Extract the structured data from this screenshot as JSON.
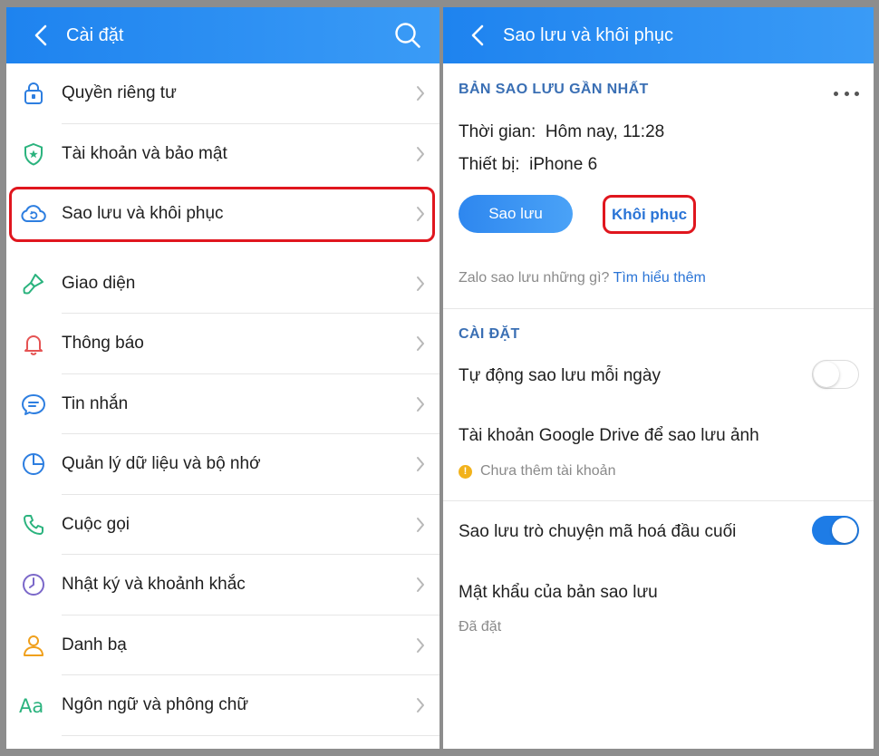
{
  "left": {
    "header": {
      "title": "Cài đặt"
    },
    "menu": [
      {
        "id": "privacy",
        "label": "Quyền riêng tư",
        "icon": "lock-icon"
      },
      {
        "id": "account",
        "label": "Tài khoản và bảo mật",
        "icon": "shield-icon"
      },
      {
        "id": "backup",
        "label": "Sao lưu và khôi phục",
        "icon": "cloud-sync-icon",
        "highlighted": true
      },
      {
        "id": "theme",
        "label": "Giao diện",
        "icon": "paintbrush-icon"
      },
      {
        "id": "notifications",
        "label": "Thông báo",
        "icon": "bell-icon"
      },
      {
        "id": "messages",
        "label": "Tin nhắn",
        "icon": "chat-bubble-icon"
      },
      {
        "id": "storage",
        "label": "Quản lý dữ liệu và bộ nhớ",
        "icon": "pie-chart-icon"
      },
      {
        "id": "calls",
        "label": "Cuộc gọi",
        "icon": "phone-icon"
      },
      {
        "id": "timeline",
        "label": "Nhật ký và khoảnh khắc",
        "icon": "clock-icon"
      },
      {
        "id": "contacts",
        "label": "Danh bạ",
        "icon": "person-icon"
      },
      {
        "id": "language",
        "label": "Ngôn ngữ và phông chữ",
        "icon": "font-aa-icon"
      }
    ]
  },
  "right": {
    "header": {
      "title": "Sao lưu và khôi phục"
    },
    "latest_backup": {
      "section_title": "BẢN SAO LƯU GẦN NHẤT",
      "time_label": "Thời gian:",
      "time_value": "Hôm nay, 11:28",
      "device_label": "Thiết bị:",
      "device_value": "iPhone 6",
      "backup_button": "Sao lưu",
      "restore_button": "Khôi phục",
      "hint_text": "Zalo sao lưu những gì?",
      "hint_link": "Tìm hiểu thêm"
    },
    "settings": {
      "section_title": "CÀI ĐẶT",
      "auto_backup_label": "Tự động sao lưu mỗi ngày",
      "auto_backup_on": false,
      "google_drive_label": "Tài khoản Google Drive để sao lưu ảnh",
      "google_drive_status": "Chưa thêm tài khoản",
      "e2e_label": "Sao lưu trò chuyện mã hoá đầu cuối",
      "e2e_on": true,
      "password_label": "Mật khẩu của bản sao lưu",
      "password_status": "Đã đặt"
    },
    "colors": {
      "accent": "#1e83ef",
      "highlight": "#e0161e",
      "link": "#2a74d6"
    }
  }
}
